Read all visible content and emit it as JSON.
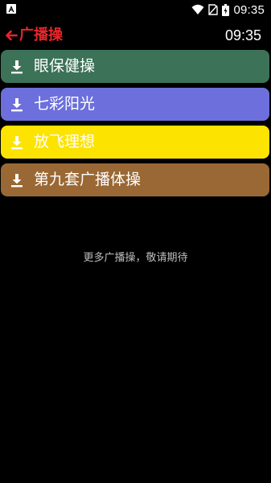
{
  "status_bar": {
    "time": "09:35",
    "icons": [
      "notification-icon",
      "wifi-icon",
      "sim-icon",
      "battery-icon"
    ],
    "battery_charging": true
  },
  "header": {
    "back_icon": "arrow-left-icon",
    "title": "广播操",
    "clock": "09:35",
    "title_color": "#e8262b"
  },
  "exercises": [
    {
      "label": "眼保健操",
      "icon": "download-icon",
      "color": "#3c7257"
    },
    {
      "label": "七彩阳光",
      "icon": "download-icon",
      "color": "#6c6fdc"
    },
    {
      "label": "放飞理想",
      "icon": "download-icon",
      "color": "#fce300"
    },
    {
      "label": "第九套广播体操",
      "icon": "download-icon",
      "color": "#9a6834"
    }
  ],
  "footer_note": "更多广播操，敬请期待"
}
